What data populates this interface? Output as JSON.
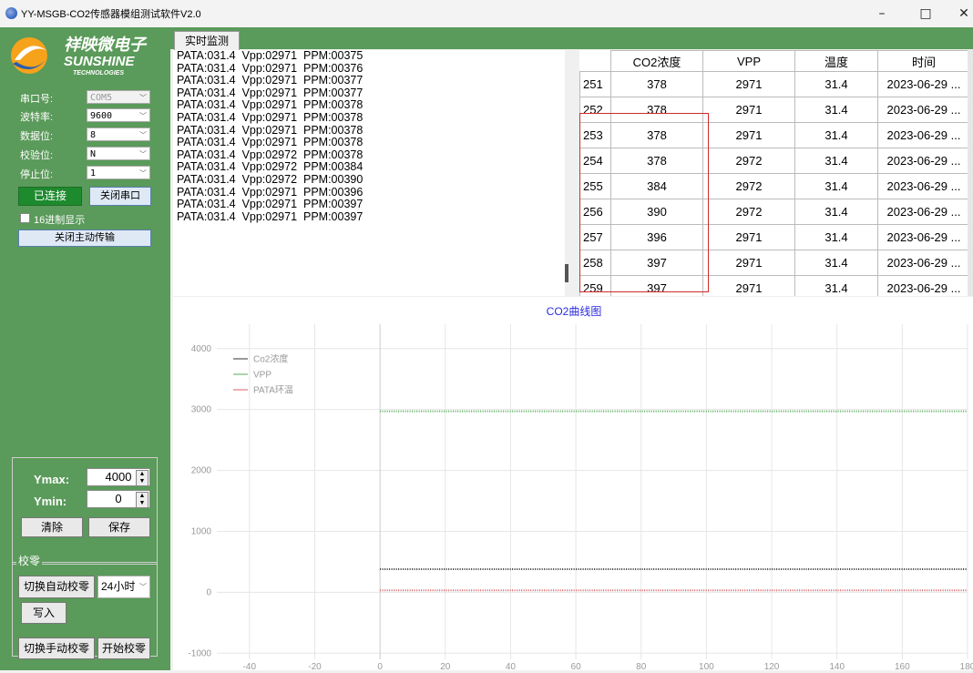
{
  "window": {
    "title": "YY-MSGB-CO2传感器模组测试软件V2.0",
    "minimize": "–",
    "maximize": "□",
    "close": "✕"
  },
  "logo": {
    "cn": "祥映微电子",
    "en": "SUNSHINE",
    "sub": "TECHNOLOGIES"
  },
  "serial": {
    "port_label": "串口号:",
    "port_value": "COM5",
    "baud_label": "波特率:",
    "baud_value": "9600",
    "data_label": "数据位:",
    "data_value": "8",
    "parity_label": "校验位:",
    "parity_value": "N",
    "stop_label": "停止位:",
    "stop_value": "1",
    "connected_label": "已连接",
    "close_port_label": "关闭串口",
    "hex_label": "16进制显示",
    "close_active_label": "关闭主动传输"
  },
  "controls": {
    "ymax_label": "Ymax:",
    "ymax_value": "4000",
    "ymin_label": "Ymin:",
    "ymin_value": "0",
    "clear_label": "清除",
    "save_label": "保存",
    "zero_group_label": "校零",
    "auto_zero_label": "切换自动校零",
    "interval_value": "24小时",
    "write_label": "写入",
    "manual_zero_label": "切换手动校零",
    "start_zero_label": "开始校零"
  },
  "tab": {
    "label": "实时监测"
  },
  "log": [
    "PATA:031.4  Vpp:02971  PPM:00375",
    "PATA:031.4  Vpp:02971  PPM:00376",
    "PATA:031.4  Vpp:02971  PPM:00377",
    "PATA:031.4  Vpp:02971  PPM:00377",
    "PATA:031.4  Vpp:02971  PPM:00378",
    "PATA:031.4  Vpp:02971  PPM:00378",
    "PATA:031.4  Vpp:02971  PPM:00378",
    "PATA:031.4  Vpp:02971  PPM:00378",
    "PATA:031.4  Vpp:02972  PPM:00378",
    "PATA:031.4  Vpp:02972  PPM:00384",
    "PATA:031.4  Vpp:02972  PPM:00390",
    "PATA:031.4  Vpp:02971  PPM:00396",
    "PATA:031.4  Vpp:02971  PPM:00397",
    "PATA:031.4  Vpp:02971  PPM:00397"
  ],
  "table": {
    "headers": [
      "CO2浓度",
      "VPP",
      "温度",
      "时间"
    ],
    "rows": [
      [
        "251",
        "378",
        "2971",
        "31.4",
        "2023-06-29 ..."
      ],
      [
        "252",
        "378",
        "2971",
        "31.4",
        "2023-06-29 ..."
      ],
      [
        "253",
        "378",
        "2971",
        "31.4",
        "2023-06-29 ..."
      ],
      [
        "254",
        "378",
        "2972",
        "31.4",
        "2023-06-29 ..."
      ],
      [
        "255",
        "384",
        "2972",
        "31.4",
        "2023-06-29 ..."
      ],
      [
        "256",
        "390",
        "2972",
        "31.4",
        "2023-06-29 ..."
      ],
      [
        "257",
        "396",
        "2971",
        "31.4",
        "2023-06-29 ..."
      ],
      [
        "258",
        "397",
        "2971",
        "31.4",
        "2023-06-29 ..."
      ],
      [
        "259",
        "397",
        "2971",
        "31.4",
        "2023-06-29 ..."
      ]
    ]
  },
  "chart_data": {
    "type": "line",
    "title": "CO2曲线图",
    "xlim": [
      -50,
      180
    ],
    "ylim": [
      -1100,
      4400
    ],
    "xticks": [
      -40,
      -20,
      0,
      20,
      40,
      60,
      80,
      100,
      120,
      140,
      160,
      180
    ],
    "yticks": [
      -1000,
      0,
      1000,
      2000,
      3000,
      4000
    ],
    "grid": true,
    "legend_position": "top-left",
    "series": [
      {
        "name": "Co2浓度",
        "color": "#333333",
        "x": [
          0,
          180
        ],
        "y": [
          380,
          380
        ]
      },
      {
        "name": "VPP",
        "color": "#55aa55",
        "x": [
          0,
          180
        ],
        "y": [
          2971,
          2971
        ]
      },
      {
        "name": "PATA环温",
        "color": "#d46060",
        "x": [
          0,
          180
        ],
        "y": [
          31.4,
          31.4
        ]
      }
    ]
  }
}
